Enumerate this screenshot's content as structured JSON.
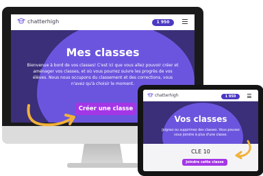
{
  "brand": {
    "name": "chatterhigh"
  },
  "coins": "1 950",
  "desktop": {
    "title": "Mes classes",
    "description": "Bienvenue à bord de vos classes! C'est ici que vous allez pouvoir créer et aménager vos classes, et où vous pourrez suivre les progrès de vos élèves. Nous nous occupons du classement et des corrections, vous n'avez qu'à choisir le moment.",
    "cta": "Créer une classe"
  },
  "tablet": {
    "title": "Vos classes",
    "description": "Joignez ou supprimez des classes. Vous pouvez vous joindre à plus d'une classe.",
    "field_label": "CLE 10",
    "cta": "Joindre cette classe"
  },
  "colors": {
    "hero_dark": "#3a2f78",
    "hero_light": "#6c55de",
    "button": "#a436e6",
    "badge": "#4b39c2",
    "arrow": "#f2b13a"
  },
  "icons": [
    "graduation-cap-logo-icon",
    "hamburger-menu-icon",
    "curved-arrow-icon"
  ]
}
